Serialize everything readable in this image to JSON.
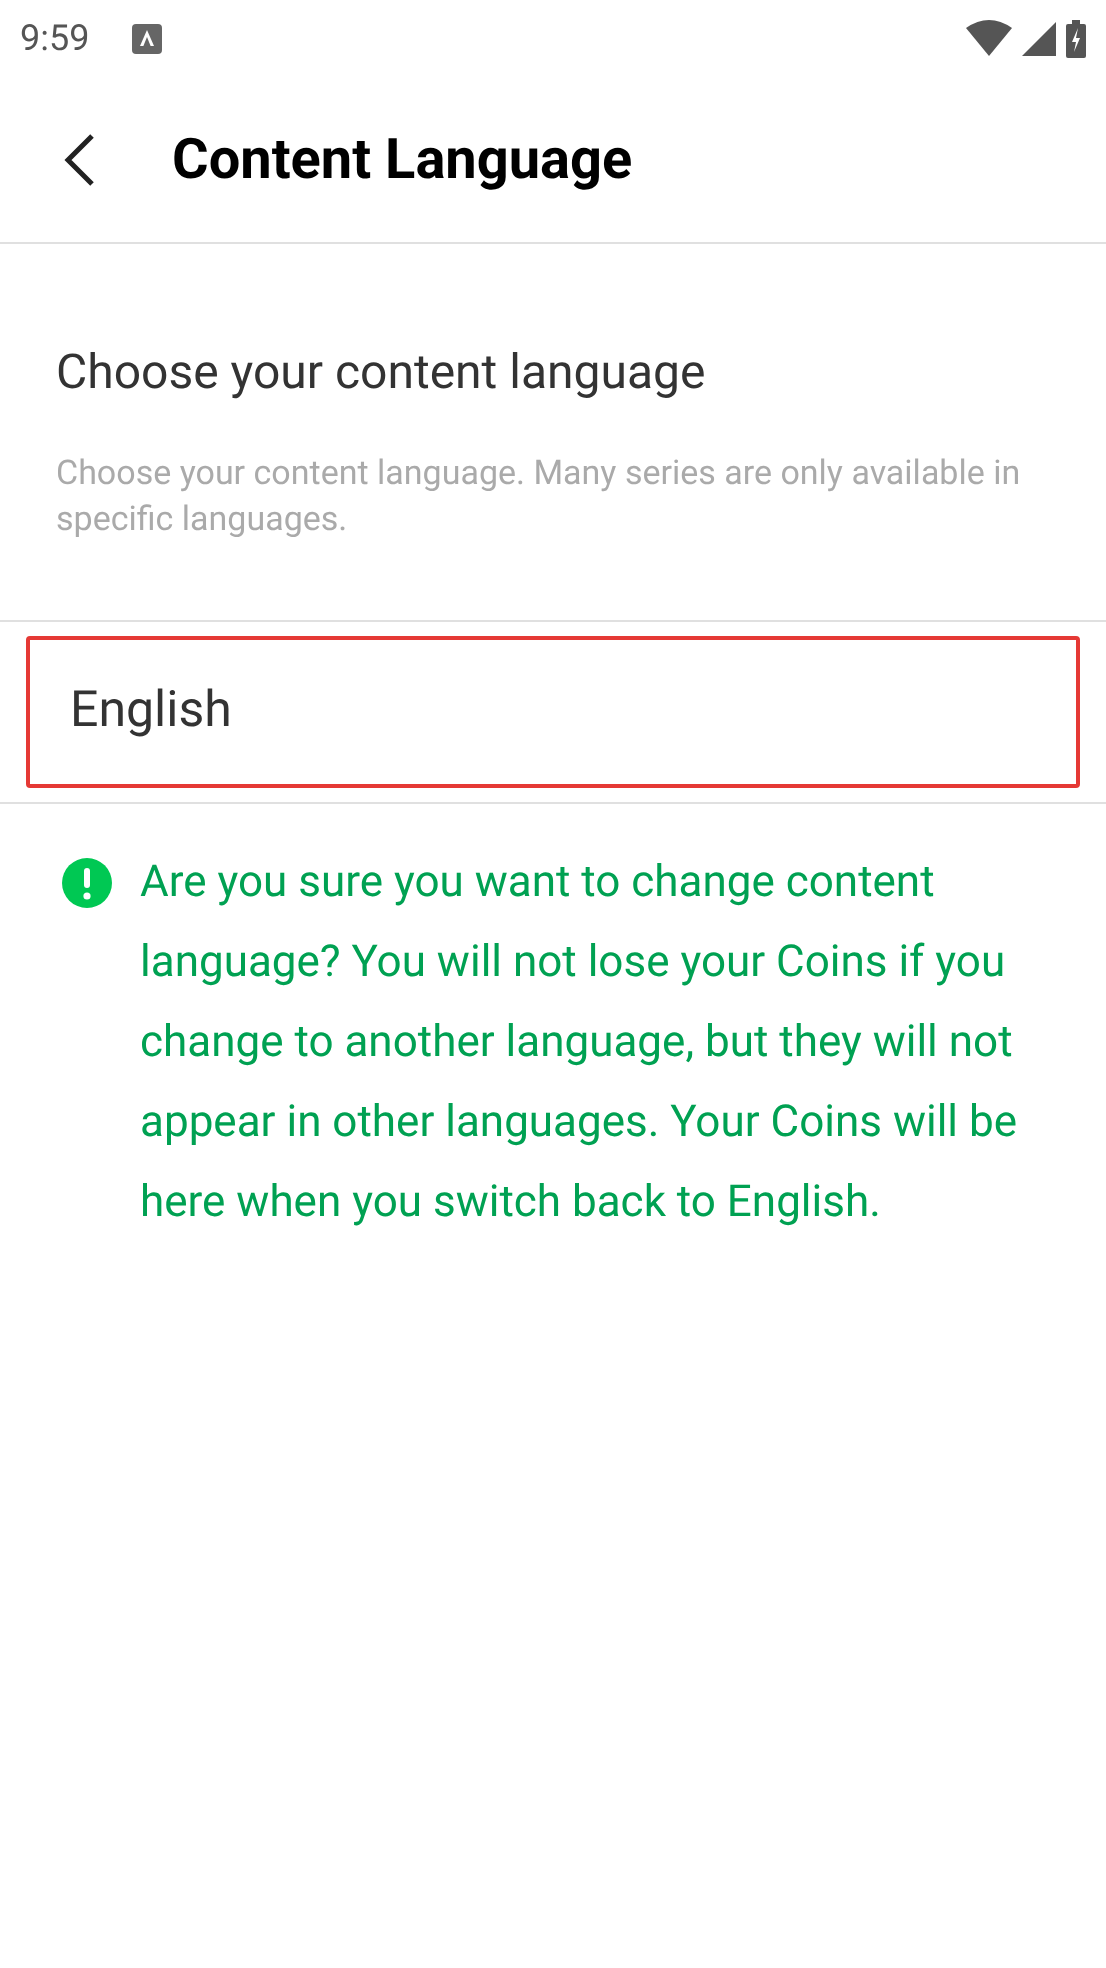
{
  "status_bar": {
    "time": "9:59"
  },
  "header": {
    "title": "Content Language"
  },
  "section": {
    "heading": "Choose your content language",
    "description": "Choose your content language. Many series are only available in specific languages."
  },
  "language_field": {
    "value": "English",
    "selected": true
  },
  "warning": {
    "text": "Are you sure you want to change content language? You will not lose your Coins if you change to another language, but they will not appear in other languages. Your Coins will be here when you switch back to English."
  }
}
